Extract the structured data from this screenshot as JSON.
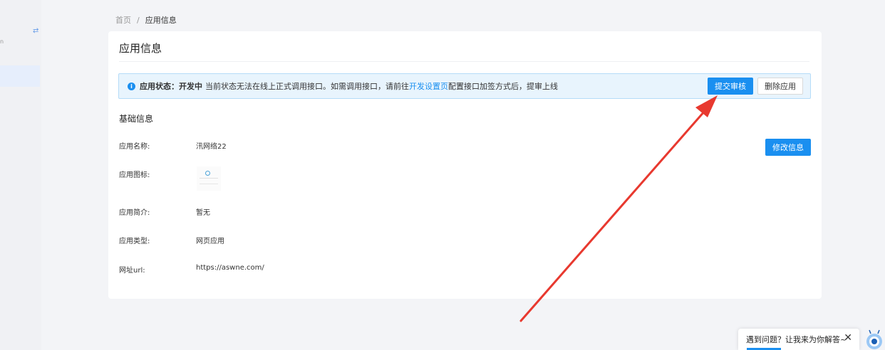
{
  "breadcrumb": {
    "home": "首页",
    "separator": "/",
    "current": "应用信息"
  },
  "card": {
    "title": "应用信息"
  },
  "alert": {
    "label": "应用状态：",
    "status": "开发中",
    "text_before_link": "当前状态无法在线上正式调用接口。如需调用接口，请前往",
    "link": "开发设置页",
    "text_after_link": "配置接口加签方式后，提审上线",
    "submit_label": "提交审核",
    "delete_label": "删除应用"
  },
  "basic": {
    "section_title": "基础信息",
    "edit_label": "修改信息",
    "rows": [
      {
        "label": "应用名称:",
        "value": "汛网络22"
      },
      {
        "label": "应用图标:",
        "value": ""
      },
      {
        "label": "应用简介:",
        "value": "暂无"
      },
      {
        "label": "应用类型:",
        "value": "网页应用"
      },
      {
        "label": "网址url:",
        "value": "https://aswne.com/"
      }
    ]
  },
  "help": {
    "text": "遇到问题？让我来为你解答~",
    "close": "✕"
  },
  "colors": {
    "primary": "#1a8ff0",
    "arrow": "#e8392f",
    "alert_bg": "#e8f4fd"
  }
}
